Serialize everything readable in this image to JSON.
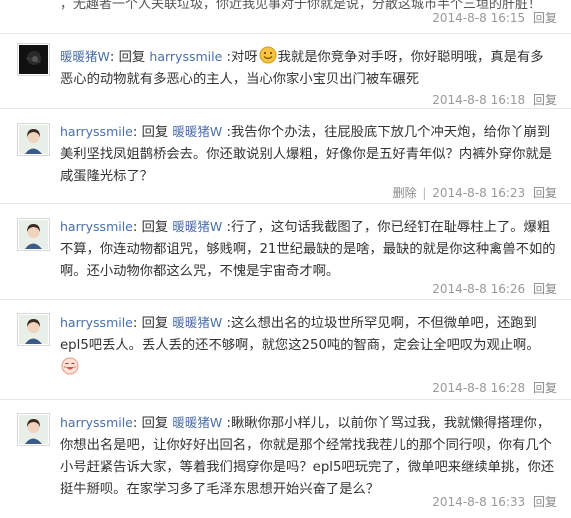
{
  "top_partial": {
    "text_fragment": "，无趣者一个人关联垃圾，你近我见事对于你就是说，分散这城市半个三垣的肝脏！",
    "time": "2014-8-8 16:15",
    "reply": "回复"
  },
  "floors": [
    {
      "author": "暖暖猪W",
      "parts": [
        ": 回复 ",
        "harryssmile",
        " :对呀",
        "[emoji]",
        "我就是你竞争对手呀，你好聪明哦，真是有多恶心的动物就有多恶心的主人，当心你家小宝贝出门被车碾死"
      ],
      "time": "2014-8-8 16:18",
      "reply": "回复",
      "delete": ""
    },
    {
      "author": "harryssmile",
      "parts": [
        ": 回复 ",
        "暖暖猪W",
        " :我告你个办法，往屁股底下放几个冲天炮，给你丫崩到美利坚找凤姐鹊桥会去。你还敢说别人爆粗，好像你是五好青年似？内裤外穿你就是咸蛋隆光标了？"
      ],
      "time": "2014-8-8 16:23",
      "reply": "回复",
      "delete": "删除"
    },
    {
      "author": "harryssmile",
      "parts": [
        ": 回复 ",
        "暖暖猪W",
        " :行了，这句话我截图了，你已经钉在耻辱柱上了。爆粗不算，你连动物都诅咒，够贱啊，21世纪最缺的是啥，最缺的就是你这种禽兽不如的啊。还小动物你都这么咒，不愧是宇宙奇才啊。"
      ],
      "time": "2014-8-8 16:26",
      "reply": "回复",
      "delete": ""
    },
    {
      "author": "harryssmile",
      "parts": [
        ": 回复 ",
        "暖暖猪W",
        " :这么想出名的垃圾世所罕见啊，不但微单吧，还跑到epl5吧丢人。丢人丢的还不够啊，就您这250吨的智商，定会让全吧叹为观止啊。",
        "[emoji]"
      ],
      "time": "2014-8-8 16:28",
      "reply": "回复",
      "delete": ""
    },
    {
      "author": "harryssmile",
      "parts": [
        ": 回复 ",
        "暖暖猪W",
        " :瞅瞅你那小样儿，以前你丫骂过我，我就懒得搭理你，你想出名是吧，让你好好出回名，你就是那个经常找我茬儿的那个同行呗，你有几个小号赶紧告诉大家，等着我们揭穿你是吗？epl5吧玩完了，微单吧来继续单挑，你还挺牛掰呗。在家学习多了毛泽东思想开始兴奋了是么？"
      ],
      "time": "2014-8-8 16:33",
      "reply": "回复",
      "delete": ""
    }
  ],
  "icons": {
    "avatar_dark": "dark-avatar-icon",
    "avatar_girl": "girl-avatar-icon",
    "emoji_smile": "smile-emoji-icon",
    "emoji_laugh": "laugh-emoji-icon"
  }
}
